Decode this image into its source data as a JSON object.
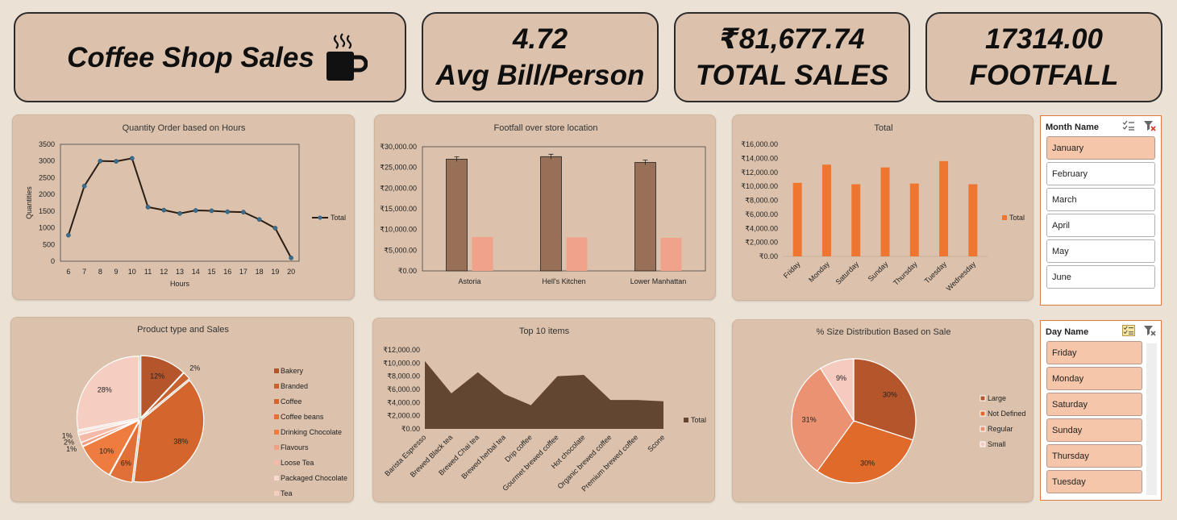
{
  "kpis": {
    "title": "Coffee Shop Sales",
    "avg_bill_value": "4.72",
    "avg_bill_label": "Avg Bill/Person",
    "total_sales_value": "₹81,677.74",
    "total_sales_label": "TOTAL SALES",
    "footfall_value": "17314.00",
    "footfall_label": "FOOTFALL"
  },
  "slicers": {
    "month": {
      "title": "Month Name",
      "items": [
        "January",
        "February",
        "March",
        "April",
        "May",
        "June"
      ],
      "selected": [
        "January"
      ]
    },
    "day": {
      "title": "Day Name",
      "items": [
        "Friday",
        "Monday",
        "Saturday",
        "Sunday",
        "Thursday",
        "Tuesday"
      ],
      "selected": [
        "Friday",
        "Monday",
        "Saturday",
        "Sunday",
        "Thursday",
        "Tuesday"
      ]
    }
  },
  "chart_data": [
    {
      "id": "hours",
      "type": "line",
      "title": "Quantity Order based on Hours",
      "xlabel": "Hours",
      "ylabel": "Quantities",
      "ylim": [
        0,
        3500
      ],
      "yticks": [
        0,
        500,
        1000,
        1500,
        2000,
        2500,
        3000,
        3500
      ],
      "x": [
        6,
        7,
        8,
        9,
        10,
        11,
        12,
        13,
        14,
        15,
        16,
        17,
        18,
        19,
        20
      ],
      "series": [
        {
          "name": "Total",
          "values": [
            780,
            2250,
            3000,
            2990,
            3080,
            1620,
            1530,
            1430,
            1520,
            1510,
            1480,
            1470,
            1250,
            990,
            100
          ]
        }
      ],
      "legend": "right",
      "color": "#2a1d14"
    },
    {
      "id": "location",
      "type": "bar",
      "title": "Footfall over store location",
      "categories": [
        "Astoria",
        "Hell's Kitchen",
        "Lower Manhattan"
      ],
      "ylim": [
        0,
        30000
      ],
      "yticks": [
        "₹0.00",
        "₹5,000.00",
        "₹10,000.00",
        "₹15,000.00",
        "₹20,000.00",
        "₹25,000.00",
        "₹30,000.00"
      ],
      "series": [
        {
          "values": [
            27000,
            27600,
            26200
          ],
          "color": "#987057"
        },
        {
          "values": [
            8200,
            8100,
            8000
          ],
          "color": "#f1a28b"
        }
      ]
    },
    {
      "id": "days",
      "type": "bar",
      "title": "Total",
      "categories": [
        "Friday",
        "Monday",
        "Saturday",
        "Sunday",
        "Thursday",
        "Tuesday",
        "Wednesday"
      ],
      "ylim": [
        0,
        16000
      ],
      "yticks": [
        "₹0.00",
        "₹2,000.00",
        "₹4,000.00",
        "₹6,000.00",
        "₹8,000.00",
        "₹10,000.00",
        "₹12,000.00",
        "₹14,000.00",
        "₹16,000.00"
      ],
      "series": [
        {
          "name": "Total",
          "values": [
            10500,
            13100,
            10300,
            12700,
            10400,
            13600,
            10300
          ],
          "color": "#ef7631"
        }
      ],
      "legend": "right"
    },
    {
      "id": "product",
      "type": "pie",
      "title": "Product type and Sales",
      "labels": [
        "Bakery",
        "Branded",
        "Coffee",
        "Coffee beans",
        "Drinking Chocolate",
        "Flavours",
        "Loose Tea",
        "Packaged Chocolate",
        "Tea"
      ],
      "values": [
        12,
        2,
        38,
        6,
        10,
        1,
        2,
        1,
        28
      ],
      "percent_labels": [
        "12%",
        "2%",
        "38%",
        "6%",
        "10%",
        "1%",
        "2%",
        "1%",
        "28%"
      ],
      "colors": [
        "#b4552b",
        "#c9622f",
        "#d4652d",
        "#e07038",
        "#ef7c3f",
        "#f2a085",
        "#f5b9a7",
        "#f8d9ce",
        "#f5cdc1"
      ],
      "legend": "right"
    },
    {
      "id": "top10",
      "type": "area",
      "title": "Top 10 items",
      "categories": [
        "Barista Espresso",
        "Brewed Black tea",
        "Brewed Chai tea",
        "Brewed herbal tea",
        "Drip coffee",
        "Gourmet brewed coffee",
        "Hot chocolate",
        "Organic brewed coffee",
        "Premium brewed coffee",
        "Scone"
      ],
      "ylim": [
        0,
        12000
      ],
      "yticks": [
        "₹0.00",
        "₹2,000.00",
        "₹4,000.00",
        "₹6,000.00",
        "₹8,000.00",
        "₹10,000.00",
        "₹12,000.00"
      ],
      "series": [
        {
          "name": "Total",
          "values": [
            10300,
            5400,
            8600,
            5300,
            3600,
            8000,
            8200,
            4400,
            4400,
            4200
          ],
          "color": "#624632"
        }
      ],
      "legend": "right"
    },
    {
      "id": "size",
      "type": "pie",
      "title": "% Size Distribution Based on Sale",
      "labels": [
        "Large",
        "Not Defined",
        "Regular",
        "Small"
      ],
      "values": [
        30,
        30,
        31,
        9
      ],
      "percent_labels": [
        "30%",
        "30%",
        "31%",
        "9%"
      ],
      "colors": [
        "#b4552b",
        "#df6a2a",
        "#ea9272",
        "#f5cbbf"
      ],
      "legend": "right"
    }
  ]
}
